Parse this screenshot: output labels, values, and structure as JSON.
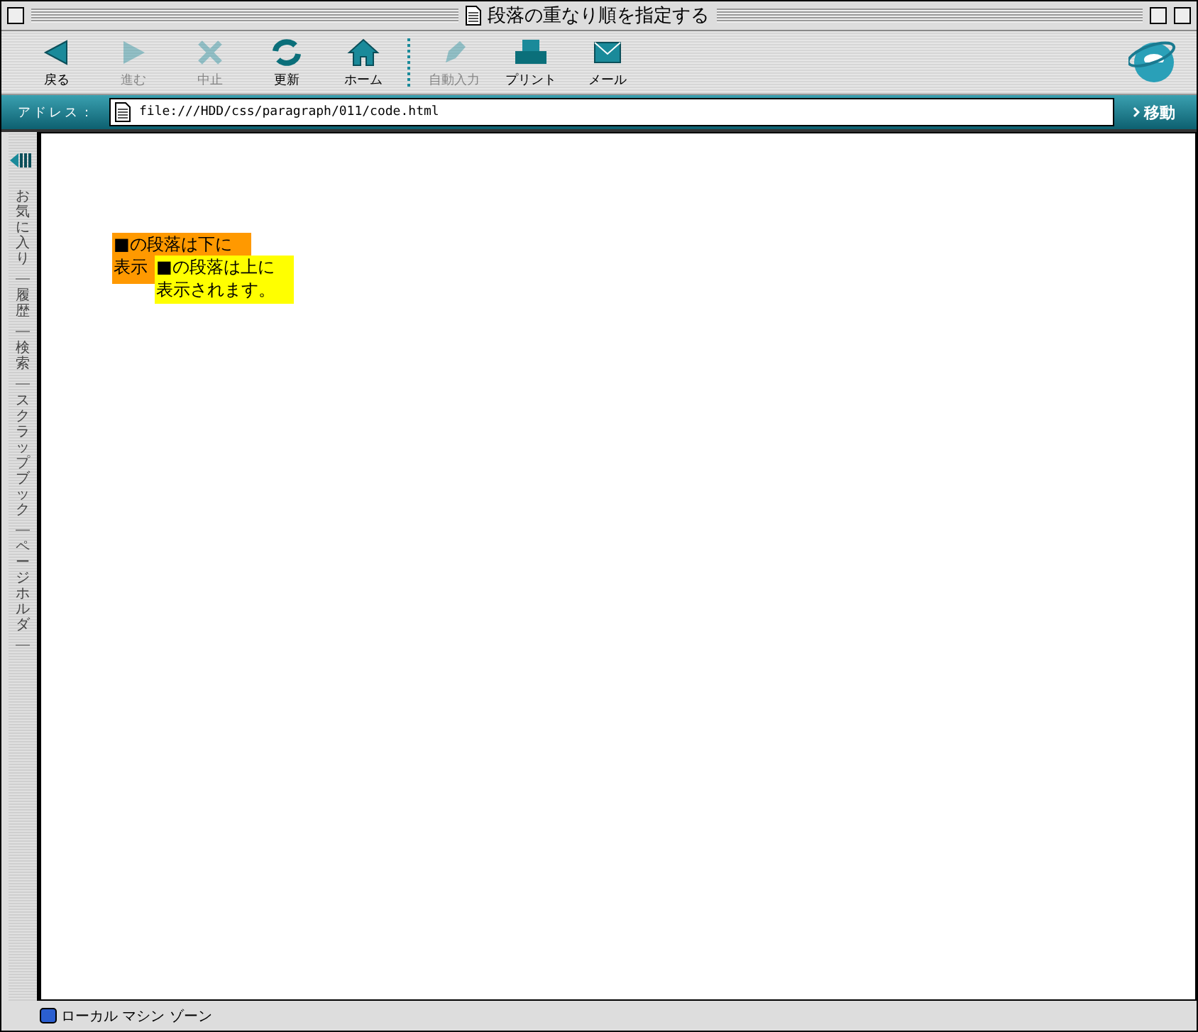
{
  "window": {
    "title": "段落の重なり順を指定する"
  },
  "toolbar": [
    {
      "label": "戻る",
      "disabled": false
    },
    {
      "label": "進む",
      "disabled": true
    },
    {
      "label": "中止",
      "disabled": true
    },
    {
      "label": "更新",
      "disabled": false
    },
    {
      "label": "ホーム",
      "disabled": false
    },
    {
      "label": "自動入力",
      "disabled": true
    },
    {
      "label": "プリント",
      "disabled": false
    },
    {
      "label": "メール",
      "disabled": false
    }
  ],
  "address_bar": {
    "label": "アドレス：",
    "value": "file:///HDD/css/paragraph/011/code.html",
    "go": "移動"
  },
  "sidebar": {
    "tabs": [
      "お気に入り",
      "履歴",
      "検索",
      "スクラップブック",
      "ページホルダ"
    ]
  },
  "content": {
    "paragraphs": [
      {
        "lines": [
          "■の段落は下に",
          "表示"
        ]
      },
      {
        "lines": [
          "■の段落は上に",
          "表示されます。"
        ]
      }
    ]
  },
  "status_bar": {
    "text": "ローカル マシン ゾーン"
  }
}
